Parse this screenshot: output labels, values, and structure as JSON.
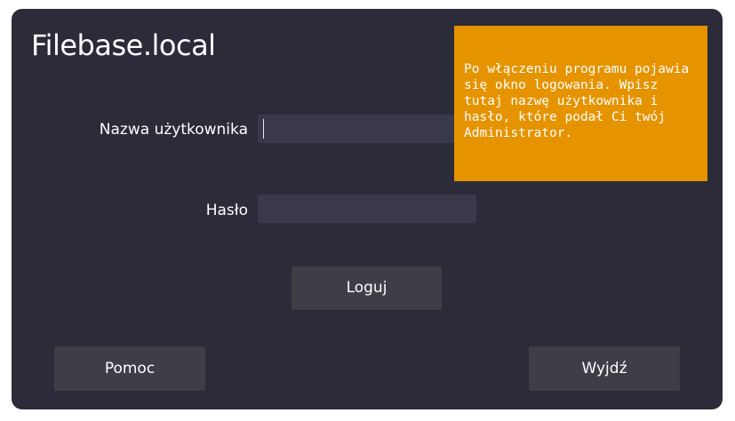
{
  "app": {
    "title": "Filebase.local"
  },
  "form": {
    "username_label": "Nazwa użytkownika",
    "username_value": "",
    "password_label": "Hasło",
    "password_value": "",
    "login_button": "Loguj"
  },
  "footer": {
    "help_button": "Pomoc",
    "exit_button": "Wyjdź"
  },
  "tooltip": {
    "text": "Po włączeniu programu pojawia się okno logowania. Wpisz tutaj nazwę użytkownika i hasło, które podał Ci twój Administrator."
  },
  "colors": {
    "window_bg": "#2b2b39",
    "input_bg": "#393949",
    "button_bg": "#3e3e47",
    "tooltip_bg": "#e69300",
    "text": "#ffffff"
  }
}
